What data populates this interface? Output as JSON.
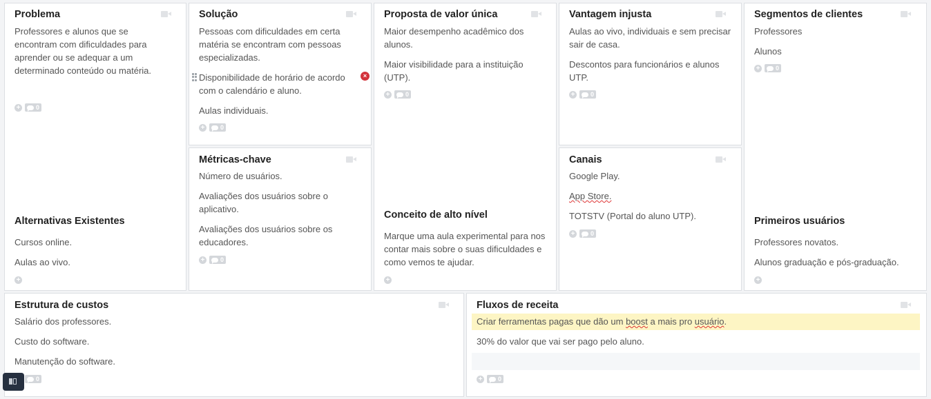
{
  "problema": {
    "title": "Problema",
    "items": [
      "Professores e alunos que se encontram com dificuldades para aprender ou se adequar a um determinado conteúdo ou matéria."
    ],
    "comments": "0",
    "sub_title": "Alternativas Existentes",
    "sub_items": [
      "Cursos online.",
      "Aulas ao vivo."
    ]
  },
  "solucao": {
    "title": "Solução",
    "items": [
      "Pessoas com dificuldades em certa matéria se encontram com pessoas especializadas.",
      "Disponibilidade de horário de acordo com o calendário e aluno.",
      "Aulas individuais."
    ],
    "comments": "0"
  },
  "metricas": {
    "title": "Métricas-chave",
    "items": [
      "Número de usuários.",
      "Avaliações dos usuários sobre o aplicativo.",
      "Avaliações dos usuários sobre os educadores."
    ],
    "comments": "0"
  },
  "proposta": {
    "title": "Proposta de valor única",
    "items": [
      "Maior desempenho acadêmico dos alunos.",
      "Maior visibilidade para a instituição (UTP)."
    ],
    "comments": "0",
    "sub_title": "Conceito de alto nível",
    "sub_items": [
      "Marque uma aula experimental para nos contar mais sobre o suas dificuldades e como vemos te ajudar."
    ]
  },
  "vantagem": {
    "title": "Vantagem injusta",
    "items": [
      "Aulas ao vivo, individuais e sem precisar sair de casa.",
      "Descontos para funcionários e alunos UTP."
    ],
    "comments": "0"
  },
  "canais": {
    "title": "Canais",
    "items": [
      "Google Play.",
      "App Store.",
      "TOTSTV (Portal do aluno UTP)."
    ],
    "comments": "0"
  },
  "segmentos": {
    "title": "Segmentos de clientes",
    "items": [
      "Professores",
      "Alunos"
    ],
    "comments": "0",
    "sub_title": "Primeiros usuários",
    "sub_items": [
      "Professores novatos.",
      "Alunos graduação e pós-graduação."
    ]
  },
  "custos": {
    "title": "Estrutura de custos",
    "items": [
      "Salário dos professores.",
      "Custo do software.",
      "Manutenção do software."
    ],
    "comments": "0"
  },
  "receita": {
    "title": "Fluxos de receita",
    "items": [
      "Criar ferramentas pagas que dão um boost a mais pro usuário.",
      "30% do valor que vai ser pago pelo aluno."
    ],
    "comments": "0"
  },
  "icons": {
    "video": "video-camera-icon",
    "add": "plus-circle-icon",
    "comment": "comment-bubble-icon",
    "remove": "remove-x-icon",
    "drag": "drag-handle-icon",
    "sidebar": "sidebar-toggle-icon"
  },
  "colors": {
    "highlight": "#fdf5c4",
    "remove": "#d3333b",
    "dark_button": "#263040"
  }
}
